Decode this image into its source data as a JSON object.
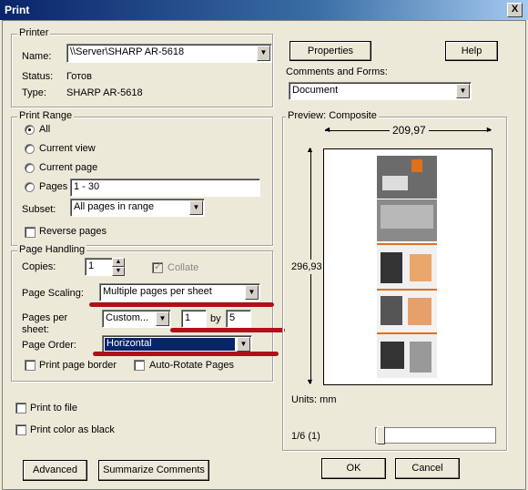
{
  "window": {
    "title": "Print",
    "close": "X"
  },
  "printer": {
    "legend": "Printer",
    "name_label": "Name:",
    "name_value": "\\\\Server\\SHARP AR-5618",
    "status_label": "Status:",
    "status_value": "Готов",
    "type_label": "Type:",
    "type_value": "SHARP AR-5618",
    "properties_button": "Properties",
    "help_button": "Help",
    "comments_label": "Comments and Forms:",
    "comments_value": "Document"
  },
  "range": {
    "legend": "Print Range",
    "all": "All",
    "current_view": "Current view",
    "current_page": "Current page",
    "pages": "Pages",
    "pages_value": "1 - 30",
    "subset_label": "Subset:",
    "subset_value": "All pages in range",
    "reverse": "Reverse pages"
  },
  "handling": {
    "legend": "Page Handling",
    "copies_label": "Copies:",
    "copies_value": "1",
    "collate": "Collate",
    "scaling_label": "Page Scaling:",
    "scaling_value": "Multiple pages per sheet",
    "pps_label_1": "Pages per",
    "pps_label_2": "sheet:",
    "pps_value": "Custom...",
    "pps_x": "1",
    "by": "by",
    "pps_y": "5",
    "order_label": "Page Order:",
    "order_value": "Horizontal",
    "print_border": "Print page border",
    "auto_rotate": "Auto-Rotate Pages"
  },
  "options": {
    "print_to_file": "Print to file",
    "color_as_black": "Print color as black"
  },
  "preview": {
    "legend": "Preview: Composite",
    "width": "209,97",
    "height": "296,93",
    "units": "Units: mm",
    "page_indicator": "1/6 (1)"
  },
  "buttons": {
    "advanced": "Advanced",
    "summarize": "Summarize Comments",
    "ok": "OK",
    "cancel": "Cancel"
  },
  "colors": {
    "title_bar": "#0a246a",
    "annotation": "#b0101a",
    "selection": "#0a246a"
  }
}
